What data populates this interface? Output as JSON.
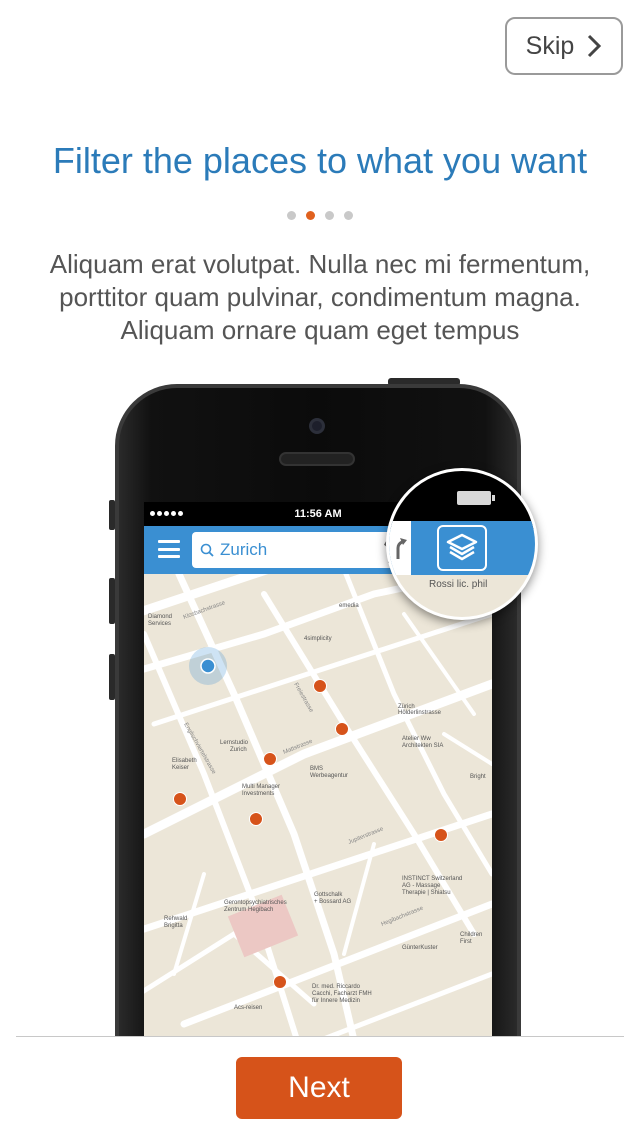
{
  "header": {
    "skip_label": "Skip",
    "title": "Filter the places to what you want"
  },
  "pager": {
    "total": 4,
    "active_index": 1
  },
  "description": "Aliquam erat volutpat. Nulla nec mi fermentum, porttitor quam pulvinar, condimentum magna. Aliquam ornare quam eget tempus",
  "phone": {
    "status_time": "11:56 AM",
    "search_text": "Zurich",
    "magnifier_label": "Rossi lic. phil",
    "map_labels": [
      "Diamond Services",
      "emedia",
      "4simplicity",
      "Lernstudio Zurich",
      "Elisabeth Keiser",
      "BMS Werbeagentur",
      "Multi Manager Investments",
      "Atelier Ww Architekten SIA",
      "Gerontopsychiatrisches Zentrum Hegibach",
      "Gottschalk + Bossard AG",
      "INSTINCT Switzerland AG - Massage | Therapie | Shiatsu",
      "Rehwald Brigitta",
      "Children First",
      "GünterKuster",
      "Dr. med. Riccardo Cacchi, Facharzt FMH für Innere Medizin",
      "Acs-reisen",
      "Zurich Hölderlinstrasse",
      "Bright"
    ]
  },
  "colors": {
    "accent_blue": "#2b7bb9",
    "accent_orange": "#d6531a",
    "nav_blue": "#3a8fd2"
  },
  "footer": {
    "next_label": "Next"
  }
}
